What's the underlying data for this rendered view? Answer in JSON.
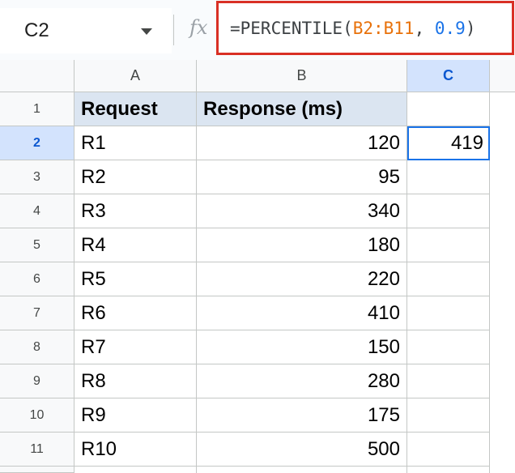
{
  "name_box": {
    "value": "C2"
  },
  "formula_bar": {
    "fx_label": "fx",
    "parts": {
      "prefix": "=PERCENTILE(",
      "range": "B2:B11",
      "sep": ", ",
      "arg": "0.9",
      "suffix": ")"
    }
  },
  "columns": [
    "A",
    "B",
    "C"
  ],
  "selected_column": "C",
  "row_numbers": [
    "1",
    "2",
    "3",
    "4",
    "5",
    "6",
    "7",
    "8",
    "9",
    "10",
    "11"
  ],
  "selected_row": "2",
  "headers": {
    "a": "Request",
    "b": "Response (ms)"
  },
  "rows": [
    {
      "request": "R1",
      "response": "120"
    },
    {
      "request": "R2",
      "response": "95"
    },
    {
      "request": "R3",
      "response": "340"
    },
    {
      "request": "R4",
      "response": "180"
    },
    {
      "request": "R5",
      "response": "220"
    },
    {
      "request": "R6",
      "response": "410"
    },
    {
      "request": "R7",
      "response": "150"
    },
    {
      "request": "R8",
      "response": "280"
    },
    {
      "request": "R9",
      "response": "175"
    },
    {
      "request": "R10",
      "response": "500"
    }
  ],
  "result_cell": {
    "address": "C2",
    "value": "419"
  },
  "colors": {
    "highlight_border": "#d93025",
    "selection": "#1a73e8",
    "header_fill": "#dbe5f1",
    "range_color": "#e8710a",
    "number_color": "#1a73e8"
  }
}
